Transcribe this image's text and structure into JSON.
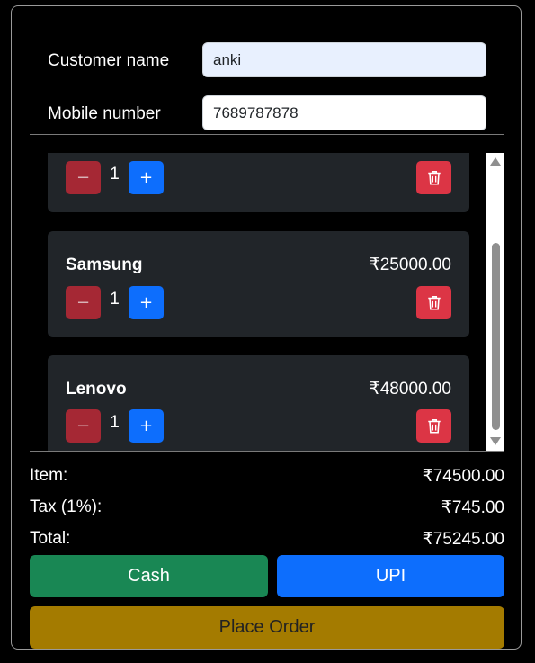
{
  "form": {
    "customer_label": "Customer name",
    "customer_value": "anki",
    "mobile_label": "Mobile number",
    "mobile_value": "7689787878"
  },
  "cart": {
    "items": [
      {
        "name": "",
        "price": "",
        "qty": "1"
      },
      {
        "name": "Samsung",
        "price": "₹25000.00",
        "qty": "1"
      },
      {
        "name": "Lenovo",
        "price": "₹48000.00",
        "qty": "1"
      }
    ],
    "minus_symbol": "−",
    "plus_symbol": "+"
  },
  "summary": {
    "item_label": "Item:",
    "item_value": "₹74500.00",
    "tax_label": "Tax (1%):",
    "tax_value": "₹745.00",
    "total_label": "Total:",
    "total_value": "₹75245.00"
  },
  "actions": {
    "cash_label": "Cash",
    "upi_label": "UPI",
    "place_order_label": "Place Order"
  },
  "colors": {
    "danger": "#dc3545",
    "danger_muted": "#a52834",
    "primary": "#0d6efd",
    "success": "#198754",
    "warning_dark": "#a47b00",
    "card_bg": "#212529"
  }
}
